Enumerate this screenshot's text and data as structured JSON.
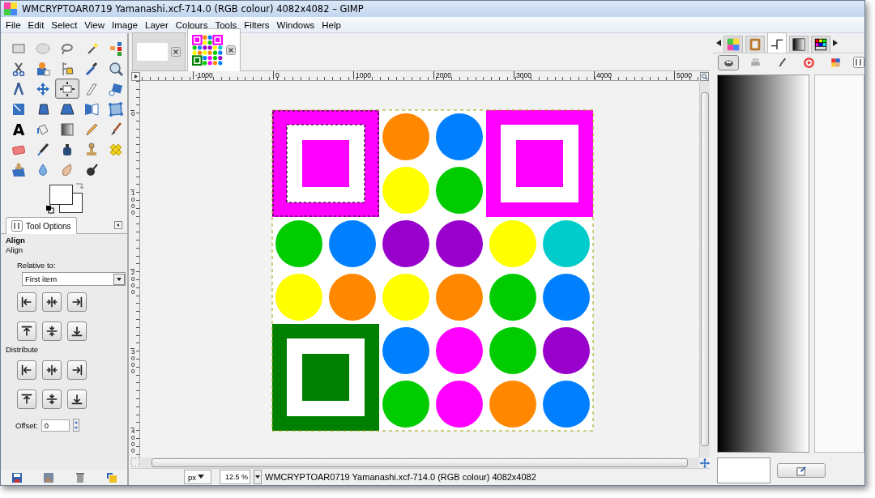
{
  "window": {
    "title": "WMCRYPTOAR0719 Yamanashi.xcf-714.0 (RGB colour) 4082x4082 – GIMP"
  },
  "menu": [
    "File",
    "Edit",
    "Select",
    "View",
    "Image",
    "Layer",
    "Colours",
    "Tools",
    "Filters",
    "Windows",
    "Help"
  ],
  "toolbox": {
    "tools": [
      {
        "selected": false
      },
      {
        "selected": false
      },
      {
        "selected": false
      },
      {
        "selected": false
      },
      {
        "selected": false
      },
      {
        "selected": false
      },
      {
        "selected": false
      },
      {
        "selected": false
      },
      {
        "selected": false
      },
      {
        "selected": false
      },
      {
        "selected": false
      },
      {
        "selected": false
      },
      {
        "selected": true
      },
      {
        "selected": false
      },
      {
        "selected": false
      },
      {
        "selected": false
      },
      {
        "selected": false
      },
      {
        "selected": false
      },
      {
        "selected": false
      },
      {
        "selected": false
      },
      {
        "selected": false,
        "glyph": "A"
      },
      {
        "selected": false
      },
      {
        "selected": false
      },
      {
        "selected": false
      },
      {
        "selected": false
      },
      {
        "selected": false
      },
      {
        "selected": false
      },
      {
        "selected": false
      },
      {
        "selected": false
      },
      {
        "selected": false
      },
      {
        "selected": false
      },
      {
        "selected": false
      },
      {
        "selected": false
      },
      {
        "selected": false
      }
    ]
  },
  "tool_options": {
    "tab": "Tool Options",
    "title": "Align",
    "section": "Align",
    "relative_label": "Relative to:",
    "relative_value": "First item",
    "distribute_label": "Distribute",
    "offset_label": "Offset:",
    "offset_value": "0"
  },
  "image_tabs": [
    {
      "selected": false
    },
    {
      "selected": true
    }
  ],
  "rulers": {
    "horizontal": [
      "-1000",
      "0",
      "1000",
      "2000",
      "3000",
      "4000",
      "5000"
    ],
    "vertical": [
      "0",
      "1000",
      "2000",
      "3000",
      "4000"
    ]
  },
  "canvas": {
    "cells": [
      [
        {
          "kind": "square",
          "color": "#ff00ff",
          "selected": true
        },
        null,
        {
          "kind": "circle",
          "color": "#ff8800"
        },
        {
          "kind": "circle",
          "color": "#0080ff"
        },
        {
          "kind": "square",
          "color": "#ff00ff",
          "selected": false
        },
        null
      ],
      [
        null,
        null,
        {
          "kind": "circle",
          "color": "#ffff00"
        },
        {
          "kind": "circle",
          "color": "#00cc00"
        },
        null,
        null
      ],
      [
        {
          "kind": "circle",
          "color": "#00cc00"
        },
        {
          "kind": "circle",
          "color": "#0080ff"
        },
        {
          "kind": "circle",
          "color": "#9900cc"
        },
        {
          "kind": "circle",
          "color": "#9900cc"
        },
        {
          "kind": "circle",
          "color": "#ffff00"
        },
        {
          "kind": "circle",
          "color": "#00cccc"
        }
      ],
      [
        {
          "kind": "circle",
          "color": "#ffff00"
        },
        {
          "kind": "circle",
          "color": "#ff8800"
        },
        {
          "kind": "circle",
          "color": "#ffff00"
        },
        {
          "kind": "circle",
          "color": "#ff8800"
        },
        {
          "kind": "circle",
          "color": "#00cc00"
        },
        {
          "kind": "circle",
          "color": "#0080ff"
        }
      ],
      [
        {
          "kind": "square",
          "color": "#008000",
          "selected": false
        },
        null,
        {
          "kind": "circle",
          "color": "#0080ff"
        },
        {
          "kind": "circle",
          "color": "#ff00ff"
        },
        {
          "kind": "circle",
          "color": "#00cc00"
        },
        {
          "kind": "circle",
          "color": "#9900cc"
        }
      ],
      [
        null,
        null,
        {
          "kind": "circle",
          "color": "#00cc00"
        },
        {
          "kind": "circle",
          "color": "#ff00ff"
        },
        {
          "kind": "circle",
          "color": "#ff8800"
        },
        {
          "kind": "circle",
          "color": "#0080ff"
        }
      ]
    ]
  },
  "status_bar": {
    "unit": "px",
    "zoom": "12.5 %",
    "text": "WMCRYPTOAR0719 Yamanashi.xcf-714.0 (RGB colour) 4082x4082"
  },
  "dock": {
    "tabs": [
      {
        "selected": false
      },
      {
        "selected": false
      },
      {
        "selected": true
      },
      {
        "selected": false
      },
      {
        "selected": false
      }
    ],
    "subtabs": [
      {
        "selected": true
      },
      {
        "selected": false
      },
      {
        "selected": false
      },
      {
        "selected": false
      },
      {
        "selected": false
      }
    ]
  }
}
